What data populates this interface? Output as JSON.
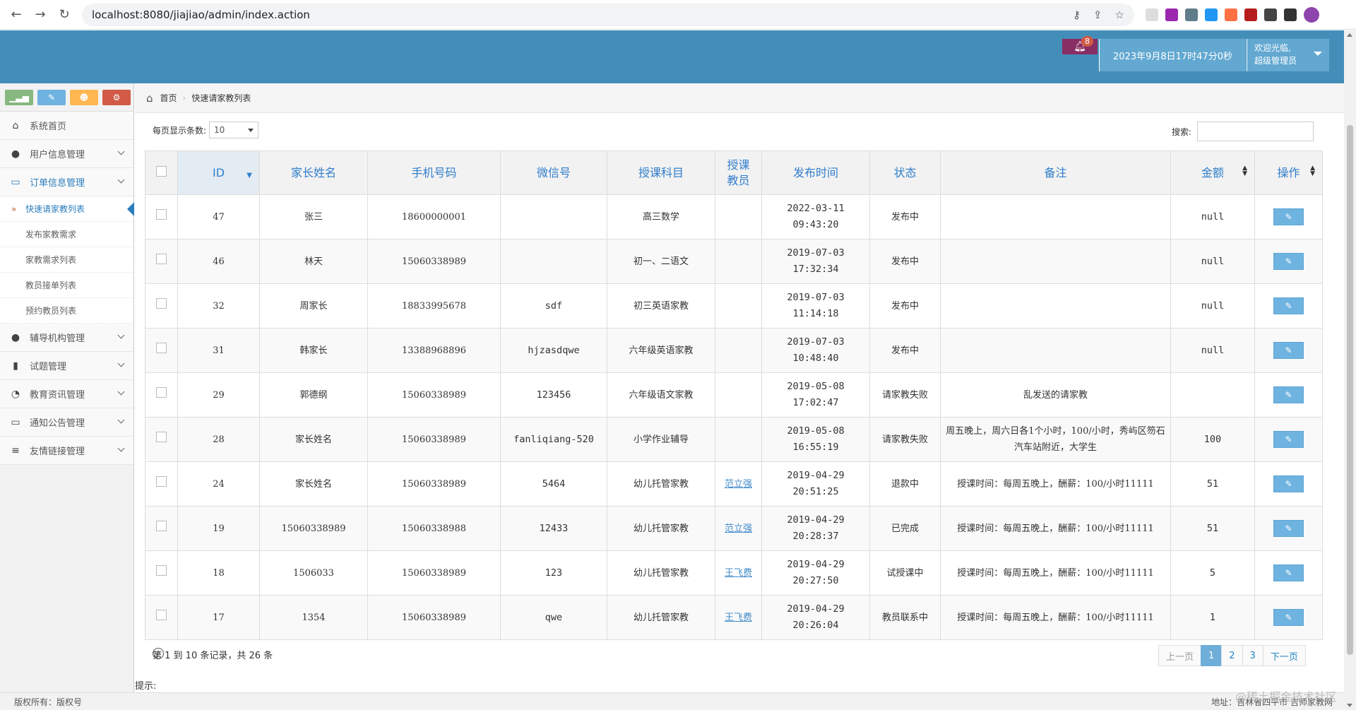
{
  "browser": {
    "url": "localhost:8080/jiajiao/admin/index.action"
  },
  "header": {
    "notification_count": "8",
    "datetime": "2023年9月8日17时47分0秒",
    "welcome": "欢迎光临,",
    "role": "超级管理员"
  },
  "breadcrumb": {
    "home": "首页",
    "current": "快速请家教列表"
  },
  "sidebar": {
    "items": [
      {
        "label": "系统首页",
        "icon": "home-icon"
      },
      {
        "label": "用户信息管理",
        "icon": "user-icon"
      },
      {
        "label": "订单信息管理",
        "icon": "credit-card-icon"
      },
      {
        "label": "辅导机构管理",
        "icon": "user-icon"
      },
      {
        "label": "试题管理",
        "icon": "bookmark-icon"
      },
      {
        "label": "教育资讯管理",
        "icon": "comments-icon"
      },
      {
        "label": "通知公告管理",
        "icon": "desktop-icon"
      },
      {
        "label": "友情链接管理",
        "icon": "list-icon"
      }
    ],
    "subitems": [
      "快速请家教列表",
      "发布家教需求",
      "家教需求列表",
      "教员接单列表",
      "预约教员列表"
    ]
  },
  "controls": {
    "length_label": "每页显示条数:",
    "length_value": "10",
    "search_label": "搜索:"
  },
  "table": {
    "headers": [
      "ID",
      "家长姓名",
      "手机号码",
      "微信号",
      "授课科目",
      "授课\n教员",
      "发布时间",
      "状态",
      "备注",
      "金额",
      "操作"
    ],
    "rows": [
      [
        "47",
        "张三",
        "18600000001",
        "",
        "高三数学",
        "",
        "2022-03-11 09:43:20",
        "发布中",
        "",
        "null"
      ],
      [
        "46",
        "林天",
        "15060338989",
        "",
        "初一、二语文",
        "",
        "2019-07-03 17:32:34",
        "发布中",
        "",
        "null"
      ],
      [
        "32",
        "周家长",
        "18833995678",
        "sdf",
        "初三英语家教",
        "",
        "2019-07-03 11:14:18",
        "发布中",
        "",
        "null"
      ],
      [
        "31",
        "韩家长",
        "13388968896",
        "hjzasdqwe",
        "六年级英语家教",
        "",
        "2019-07-03 10:48:40",
        "发布中",
        "",
        "null"
      ],
      [
        "29",
        "郭德纲",
        "15060338989",
        "123456",
        "六年级语文家教",
        "",
        "2019-05-08 17:02:47",
        "请家教失败",
        "乱发送的请家教",
        ""
      ],
      [
        "28",
        "家长姓名",
        "15060338989",
        "fanliqiang-520",
        "小学作业辅导",
        "",
        "2019-05-08 16:55:19",
        "请家教失败",
        "周五晚上，周六日各1个小时，100/小时，秀屿区笏石汽车站附近，大学生",
        "100"
      ],
      [
        "24",
        "家长姓名",
        "15060338989",
        "5464",
        "幼儿托管家教",
        "范立强",
        "2019-04-29 20:51:25",
        "退款中",
        "授课时间：每周五晚上，酬薪：100/小时11111",
        "51"
      ],
      [
        "19",
        "15060338989",
        "15060338988",
        "12433",
        "幼儿托管家教",
        "范立强",
        "2019-04-29 20:28:37",
        "已完成",
        "授课时间：每周五晚上，酬薪：100/小时11111",
        "51"
      ],
      [
        "18",
        "1506033",
        "15060338989",
        "123",
        "幼儿托管家教",
        "王飞费",
        "2019-04-29 20:27:50",
        "试授课中",
        "授课时间：每周五晚上，酬薪：100/小时11111",
        "5"
      ],
      [
        "17",
        "1354",
        "15060338989",
        "qwe",
        "幼儿托管家教",
        "王飞费",
        "2019-04-29 20:26:04",
        "教员联系中",
        "授课时间：每周五晚上，酬薪：100/小时11111",
        "1"
      ]
    ]
  },
  "pager": {
    "info": "第 1 到 10 条记录，共 26 条",
    "prev": "上一页",
    "pages": [
      "1",
      "2",
      "3"
    ],
    "next": "下一页"
  },
  "tip": "提示:",
  "footer": {
    "left": "版权所有：版权号",
    "right": "地址：吉林省四平市 吉师家教网",
    "watermark": "@稀土掘金技术社区"
  },
  "colors": {
    "header": "#438eb9",
    "accent": "#307ecc",
    "button": "#6fb3e0"
  }
}
